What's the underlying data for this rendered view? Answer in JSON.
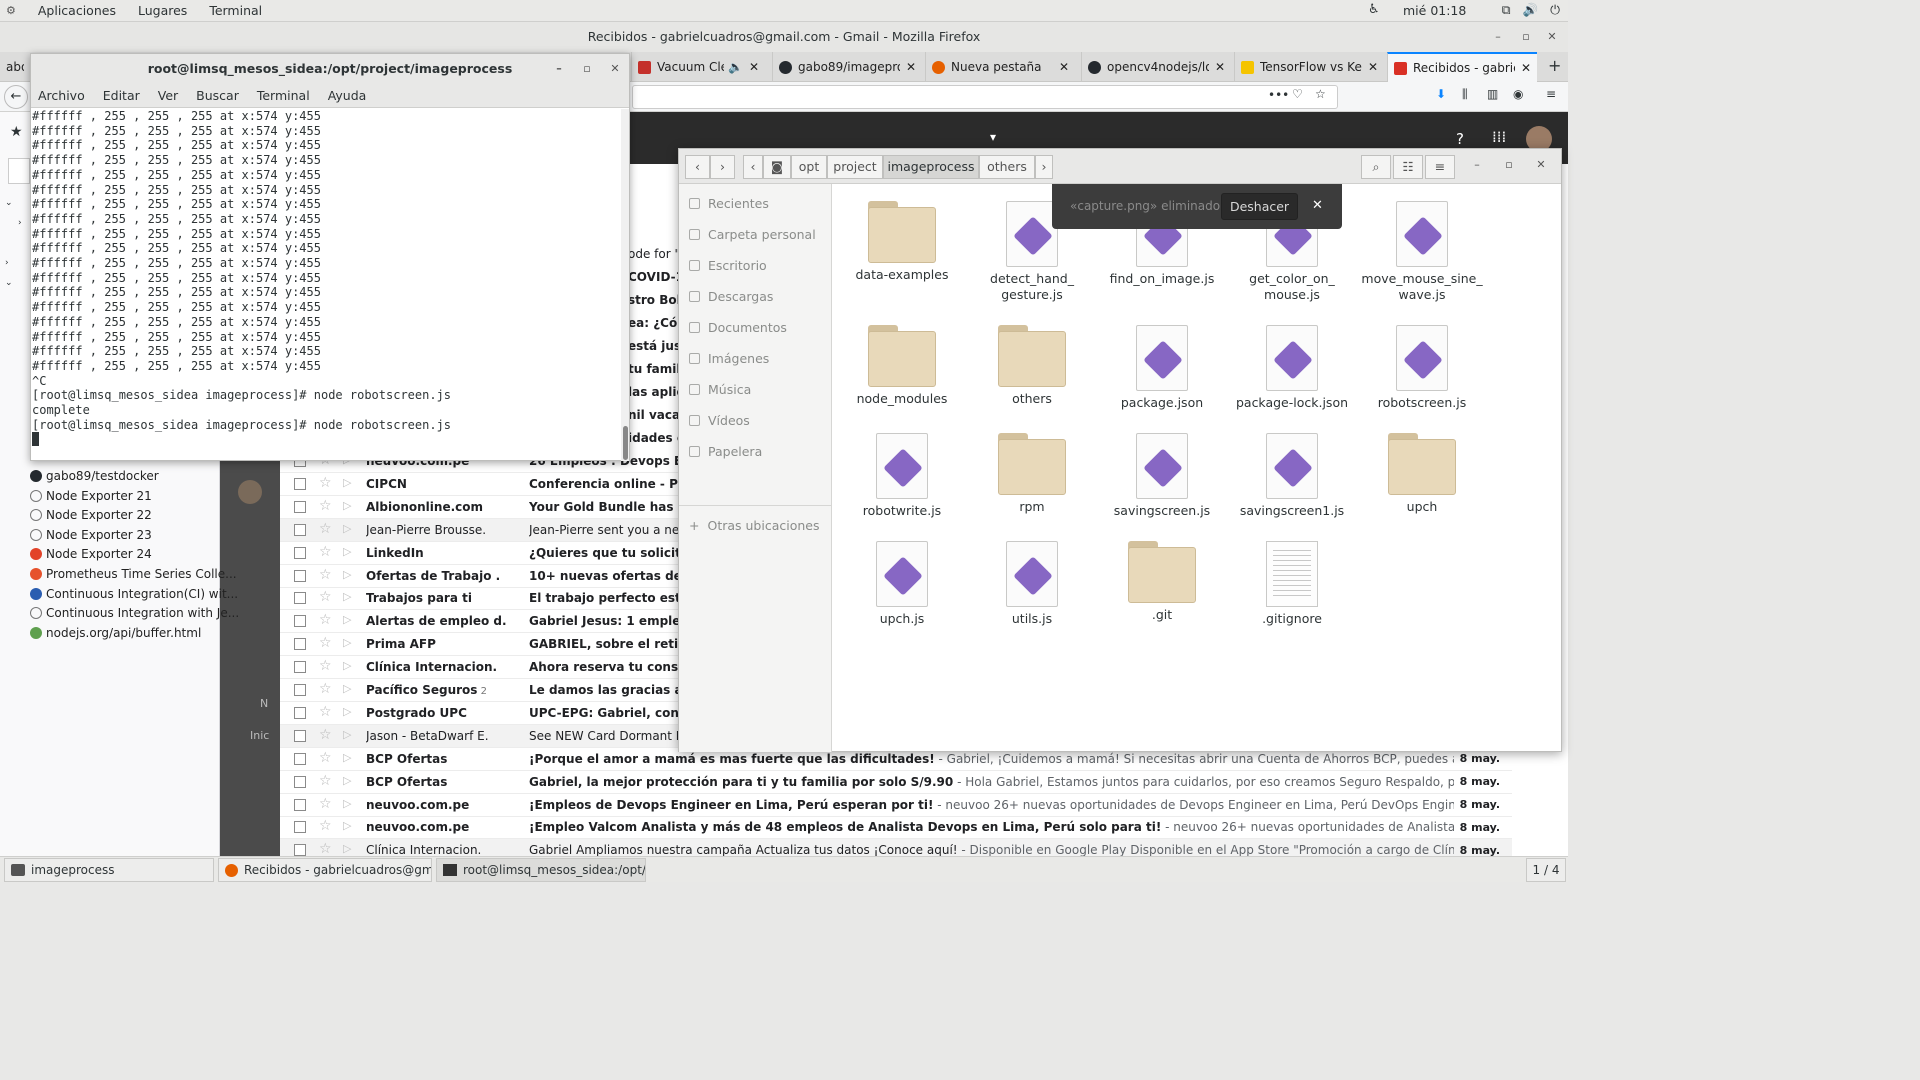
{
  "topbar": {
    "menu": [
      "Aplicaciones",
      "Lugares",
      "Terminal"
    ],
    "clock": "mié 01:18"
  },
  "firefox": {
    "title": "Recibidos - gabrielcuadros@gmail.com - Gmail - Mozilla Firefox",
    "tab_partial": "abou",
    "tabs": [
      {
        "label": "Vacuum Cleaner",
        "fav": "#c4302b"
      },
      {
        "label": "gabo89/imageproce",
        "fav": "#24292e"
      },
      {
        "label": "Nueva pestaña",
        "fav": "#e66000"
      },
      {
        "label": "opencv4nodejs/loa",
        "fav": "#24292e"
      },
      {
        "label": "TensorFlow vs Kera",
        "fav": "#f5c400"
      },
      {
        "label": "Recibidos - gabrielc",
        "fav": "#d93025"
      }
    ]
  },
  "bookmarks": [
    {
      "label": "gabo89/testdocker",
      "icon": "github-icon",
      "color": "#24292e"
    },
    {
      "label": "Node Exporter 21",
      "icon": "globe-icon",
      "color": "#777777"
    },
    {
      "label": "Node Exporter 22",
      "icon": "globe-icon",
      "color": "#777777"
    },
    {
      "label": "Node Exporter 23",
      "icon": "globe-icon",
      "color": "#777777"
    },
    {
      "label": "Node Exporter 24",
      "icon": "gitlab-icon",
      "color": "#e24329"
    },
    {
      "label": "Prometheus Time Series Colle...",
      "icon": "prometheus-icon",
      "color": "#e6522c"
    },
    {
      "label": "Continuous Integration(CI) wit...",
      "icon": "w-icon",
      "color": "#2a5db0"
    },
    {
      "label": "Continuous Integration with Je...",
      "icon": "globe-icon",
      "color": "#777777"
    },
    {
      "label": "nodejs.org/api/buffer.html",
      "icon": "node-icon",
      "color": "#5fa04e"
    }
  ],
  "gmail": {
    "side_labels": [
      "N",
      "Inic"
    ],
    "partials": [
      "ode for \"C",
      "COVID-19",
      "stro Bolet",
      "ea: ¿Cóm",
      "está just",
      "tu familia",
      "las aplica",
      "nil vacant",
      "idades el"
    ],
    "rows": [
      {
        "sender": "neuvoo.com.pe",
        "subject": "26 Empleos : Devops Engine",
        "snippet": "",
        "date": "",
        "read": false
      },
      {
        "sender": "CIPCN",
        "subject": "Conferencia online - Por Qué",
        "snippet": "",
        "date": "",
        "read": false
      },
      {
        "sender": "Albiononline.com",
        "subject": "Your Gold Bundle has arrive",
        "snippet": "",
        "date": "",
        "read": false
      },
      {
        "sender": "Jean-Pierre Brousse.",
        "subject": "Jean-Pierre sent you a new m",
        "snippet": "",
        "date": "",
        "read": true
      },
      {
        "sender": "LinkedIn",
        "subject": "¿Quieres que tu solicitud de",
        "snippet": "",
        "date": "",
        "read": false
      },
      {
        "sender": "Ofertas de Trabajo .",
        "subject": "10+ nuevas ofertas de empl",
        "snippet": "",
        "date": "",
        "read": false
      },
      {
        "sender": "Trabajos para ti",
        "subject": "El trabajo perfecto está just",
        "snippet": "",
        "date": "",
        "read": false
      },
      {
        "sender": "Alertas de empleo d.",
        "subject": "Gabriel Jesus: 1 empleo nue",
        "snippet": "",
        "date": "",
        "read": false
      },
      {
        "sender": "Prima AFP",
        "subject": "GABRIEL, sobre el retiro de l",
        "snippet": "",
        "date": "",
        "read": false
      },
      {
        "sender": "Clínica Internacion.",
        "subject": "Ahora reserva tu consulta vi",
        "snippet": "",
        "date": "",
        "read": false
      },
      {
        "sender": "Pacífico Seguros",
        "count": "2",
        "subject": "Le damos las gracias a Mam",
        "snippet": "",
        "date": "",
        "read": false
      },
      {
        "sender": "Postgrado UPC",
        "subject": "UPC-EPG: Gabriel, conéctate",
        "snippet": "",
        "date": "",
        "read": false
      },
      {
        "sender": "Jason - BetaDwarf E.",
        "subject": "See NEW Card Dormant Defe",
        "snippet": "",
        "date": "",
        "read": true
      },
      {
        "sender": "BCP Ofertas",
        "subject": "¡Porque el amor a mamá es mas fuerte que las dificultades!",
        "snippet": " - Gabriel, ¡Cuidemos a mamá! Si necesitas abrir una Cuenta de Ahorros BCP, puedes abrirla desde casa, a trav...",
        "date": "8 may.",
        "read": false
      },
      {
        "sender": "BCP Ofertas",
        "subject": "Gabriel, la mejor protección para ti y tu familia por solo S/9.90",
        "snippet": " - Hola Gabriel, Estamos juntos para cuidarlos, por eso creamos Seguro Respaldo, para protegerte a ti y a tu...",
        "date": "8 may.",
        "read": false
      },
      {
        "sender": "neuvoo.com.pe",
        "subject": "¡Empleos de Devops Engineer en Lima, Perú esperan por ti!",
        "snippet": " - neuvoo 26+ nuevas oportunidades de Devops Engineer en Lima, Perú DevOps Engineer Michael Page - Lima, ...",
        "date": "8 may.",
        "read": false
      },
      {
        "sender": "neuvoo.com.pe",
        "subject": "¡Empleo Valcom Analista y más de 48 empleos de Analista Devops en Lima, Perú solo para ti!",
        "snippet": " - neuvoo 26+ nuevas oportunidades de Analista Devops en Lima, Perú Emp...",
        "date": "8 may.",
        "read": false
      },
      {
        "sender": "Clínica Internacion.",
        "subject": "Gabriel Ampliamos nuestra campaña Actualiza tus datos ¡Conoce aquí!",
        "snippet": " - Disponible en Google Play Disponible en el App Store \"Promoción a cargo de Clínica Internacional ...",
        "date": "8 may.",
        "read": true
      }
    ]
  },
  "terminal": {
    "title": "root@limsq_mesos_sidea:/opt/project/imageprocess",
    "menu": [
      "Archivo",
      "Editar",
      "Ver",
      "Buscar",
      "Terminal",
      "Ayuda"
    ],
    "text": "#ffffff , 255 , 255 , 255 at x:574 y:455\n#ffffff , 255 , 255 , 255 at x:574 y:455\n#ffffff , 255 , 255 , 255 at x:574 y:455\n#ffffff , 255 , 255 , 255 at x:574 y:455\n#ffffff , 255 , 255 , 255 at x:574 y:455\n#ffffff , 255 , 255 , 255 at x:574 y:455\n#ffffff , 255 , 255 , 255 at x:574 y:455\n#ffffff , 255 , 255 , 255 at x:574 y:455\n#ffffff , 255 , 255 , 255 at x:574 y:455\n#ffffff , 255 , 255 , 255 at x:574 y:455\n#ffffff , 255 , 255 , 255 at x:574 y:455\n#ffffff , 255 , 255 , 255 at x:574 y:455\n#ffffff , 255 , 255 , 255 at x:574 y:455\n#ffffff , 255 , 255 , 255 at x:574 y:455\n#ffffff , 255 , 255 , 255 at x:574 y:455\n#ffffff , 255 , 255 , 255 at x:574 y:455\n#ffffff , 255 , 255 , 255 at x:574 y:455\n#ffffff , 255 , 255 , 255 at x:574 y:455\n^C\n[root@limsq_mesos_sidea imageprocess]# node robotscreen.js\ncomplete\n[root@limsq_mesos_sidea imageprocess]# node robotscreen.js\n"
  },
  "nautilus": {
    "path": [
      "opt",
      "project",
      "imageprocess",
      "others"
    ],
    "places": [
      "Recientes",
      "Carpeta personal",
      "Escritorio",
      "Descargas",
      "Documentos",
      "Imágenes",
      "Música",
      "Vídeos",
      "Papelera"
    ],
    "other_places": "Otras ubicaciones",
    "files": [
      {
        "name": "data-examples",
        "kind": "folder"
      },
      {
        "name": "detect_hand_\ngesture.js",
        "kind": "js"
      },
      {
        "name": "find_on_image.js",
        "kind": "js"
      },
      {
        "name": "get_color_on_\nmouse.js",
        "kind": "js"
      },
      {
        "name": "move_mouse_sine_\nwave.js",
        "kind": "js"
      },
      {
        "name": "node_modules",
        "kind": "folder"
      },
      {
        "name": "others",
        "kind": "folder"
      },
      {
        "name": "package.json",
        "kind": "js"
      },
      {
        "name": "package-lock.json",
        "kind": "js"
      },
      {
        "name": "robotscreen.js",
        "kind": "js"
      },
      {
        "name": "robotwrite.js",
        "kind": "js"
      },
      {
        "name": "rpm",
        "kind": "folder"
      },
      {
        "name": "savingscreen.js",
        "kind": "js"
      },
      {
        "name": "savingscreen1.js",
        "kind": "js"
      },
      {
        "name": "upch",
        "kind": "folder"
      },
      {
        "name": "upch.js",
        "kind": "js"
      },
      {
        "name": "utils.js",
        "kind": "js"
      },
      {
        "name": ".git",
        "kind": "folder"
      },
      {
        "name": ".gitignore",
        "kind": "txt"
      }
    ],
    "toast": {
      "message": "«capture.png» eliminado",
      "undo": "Deshacer"
    }
  },
  "taskbar": {
    "items": [
      {
        "label": "imageprocess",
        "icon": "files-icon"
      },
      {
        "label": "Recibidos - gabrielcuadros@gmail.co...",
        "icon": "firefox-icon"
      },
      {
        "label": "root@limsq_mesos_sidea:/opt/proj...",
        "icon": "terminal-icon"
      }
    ],
    "workspace": "1 / 4"
  }
}
